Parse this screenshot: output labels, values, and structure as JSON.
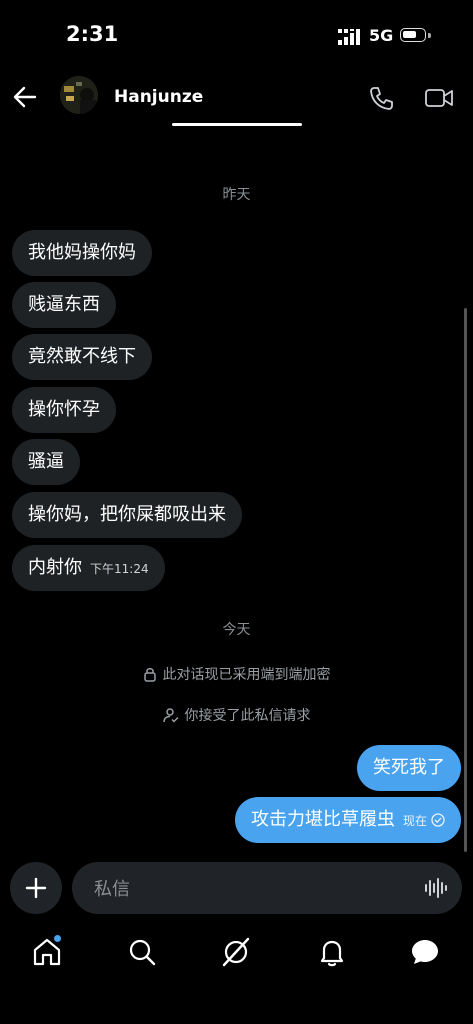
{
  "status_bar": {
    "time": "2:31",
    "network": "5G"
  },
  "header": {
    "contact_name": "Hanjunze"
  },
  "chat": {
    "day_yesterday": "昨天",
    "incoming": [
      "我他妈操你妈",
      "贱逼东西",
      "竟然敢不线下",
      "操你怀孕",
      "骚逼",
      "操你妈，把你屎都吸出来",
      "内射你"
    ],
    "last_incoming_time": "下午11:24",
    "day_today": "今天",
    "system_encrypted": "此对话现已采用端到端加密",
    "system_accepted": "你接受了此私信请求",
    "outgoing": [
      "笑死我了",
      "攻击力堪比草履虫"
    ],
    "last_outgoing_status": "现在"
  },
  "composer": {
    "placeholder": "私信"
  },
  "colors": {
    "accent": "#4aa3ef",
    "incoming_bubble": "#1f2225",
    "background": "#000000"
  },
  "icons": {
    "header": [
      "back-arrow-icon",
      "phone-icon",
      "video-camera-icon"
    ],
    "tabs": [
      "home-icon",
      "search-icon",
      "grok-icon",
      "bell-icon",
      "messages-icon"
    ]
  }
}
